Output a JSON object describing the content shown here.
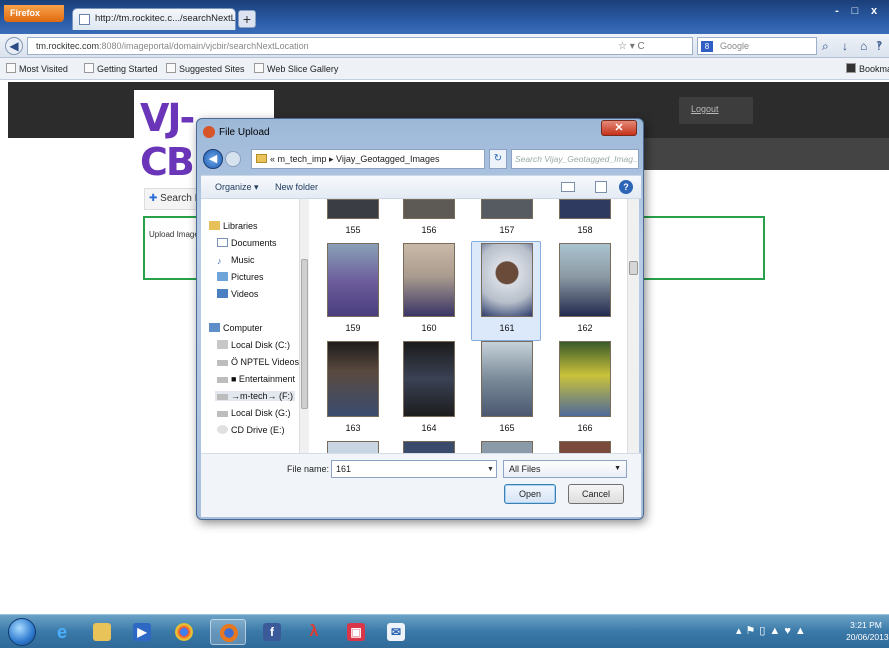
{
  "browser": {
    "app_button": "Firefox",
    "tab_title": "http://tm.rockitec.c.../searchNextLocation",
    "new_tab": "+",
    "url_host": "tm.rockitec.com",
    "url_path": ":8080/imageportal/domain/vjcbir/searchNextLocation",
    "search_engine": "Google",
    "window_controls": {
      "minimize": "-",
      "maximize": "□",
      "close": "x"
    },
    "bookmarks": [
      "Most Visited",
      "Getting Started",
      "Suggested Sites",
      "Web Slice Gallery"
    ],
    "bookmarks_right": "Bookma"
  },
  "site": {
    "logo": "VJ-CBIR",
    "logout": "Logout",
    "search_link": "Search Il",
    "upload_label": "Upload Image"
  },
  "dialog": {
    "title": "File Upload",
    "breadcrumb": "«  m_tech_imp  ▸  Vijay_Geotagged_Images",
    "search_placeholder": "Search Vijay_Geotagged_Imag...",
    "organize": "Organize ▾",
    "new_folder": "New folder",
    "nav": {
      "libraries": "Libraries",
      "documents": "Documents",
      "music": "Music",
      "pictures": "Pictures",
      "videos": "Videos",
      "computer": "Computer",
      "local_c": "Local Disk (C:)",
      "nptel": "Ö  NPTEL Videos",
      "entertainment": "■ Entertainment",
      "mtech": "→m-tech→ (F:)",
      "local_g": "Local Disk (G:)",
      "cd": "CD Drive (E:)"
    },
    "files": [
      "155",
      "156",
      "157",
      "158",
      "159",
      "160",
      "161",
      "162",
      "163",
      "164",
      "165",
      "166"
    ],
    "selected_file": "161",
    "file_name_label": "File name:",
    "file_name_value": "161",
    "file_type": "All Files",
    "open_button": "Open",
    "cancel_button": "Cancel"
  },
  "taskbar": {
    "time": "3:21 PM",
    "date": "20/06/2013"
  }
}
